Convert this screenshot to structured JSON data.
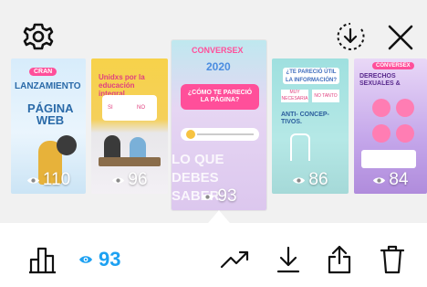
{
  "header": {
    "settings_icon": "gear-icon",
    "download_icon": "download-icon",
    "close_icon": "close-icon"
  },
  "stories": [
    {
      "views": "110",
      "lines": [
        "CRAN",
        "LANZAMIENTO",
        "PÁGINA WEB"
      ]
    },
    {
      "views": "96",
      "lines": [
        "Unidxs por la educación integral",
        "SI",
        "NO"
      ]
    },
    {
      "views": "93",
      "lines": [
        "CONVERSEX",
        "2020",
        "¿CÓMO TE PARECIÓ LA PÁGINA?",
        "LO QUE",
        "DEBES",
        "SABER"
      ]
    },
    {
      "views": "86",
      "lines": [
        "¿TE PARECIÓ ÚTIL LA INFORMACIÓN?",
        "MUY NECESARIA",
        "NO TANTO",
        "ANTI- CONCEP- TIVOS."
      ]
    },
    {
      "views": "84",
      "lines": [
        "CONVERSEX",
        "DERECHOS SEXUALES &"
      ]
    }
  ],
  "toolbar": {
    "insights_icon": "bar-chart-icon",
    "views_count": "93",
    "promote_icon": "trending-up-icon",
    "save_icon": "download-icon",
    "share_icon": "share-icon",
    "delete_icon": "trash-icon",
    "accent": "#1da1f2"
  }
}
